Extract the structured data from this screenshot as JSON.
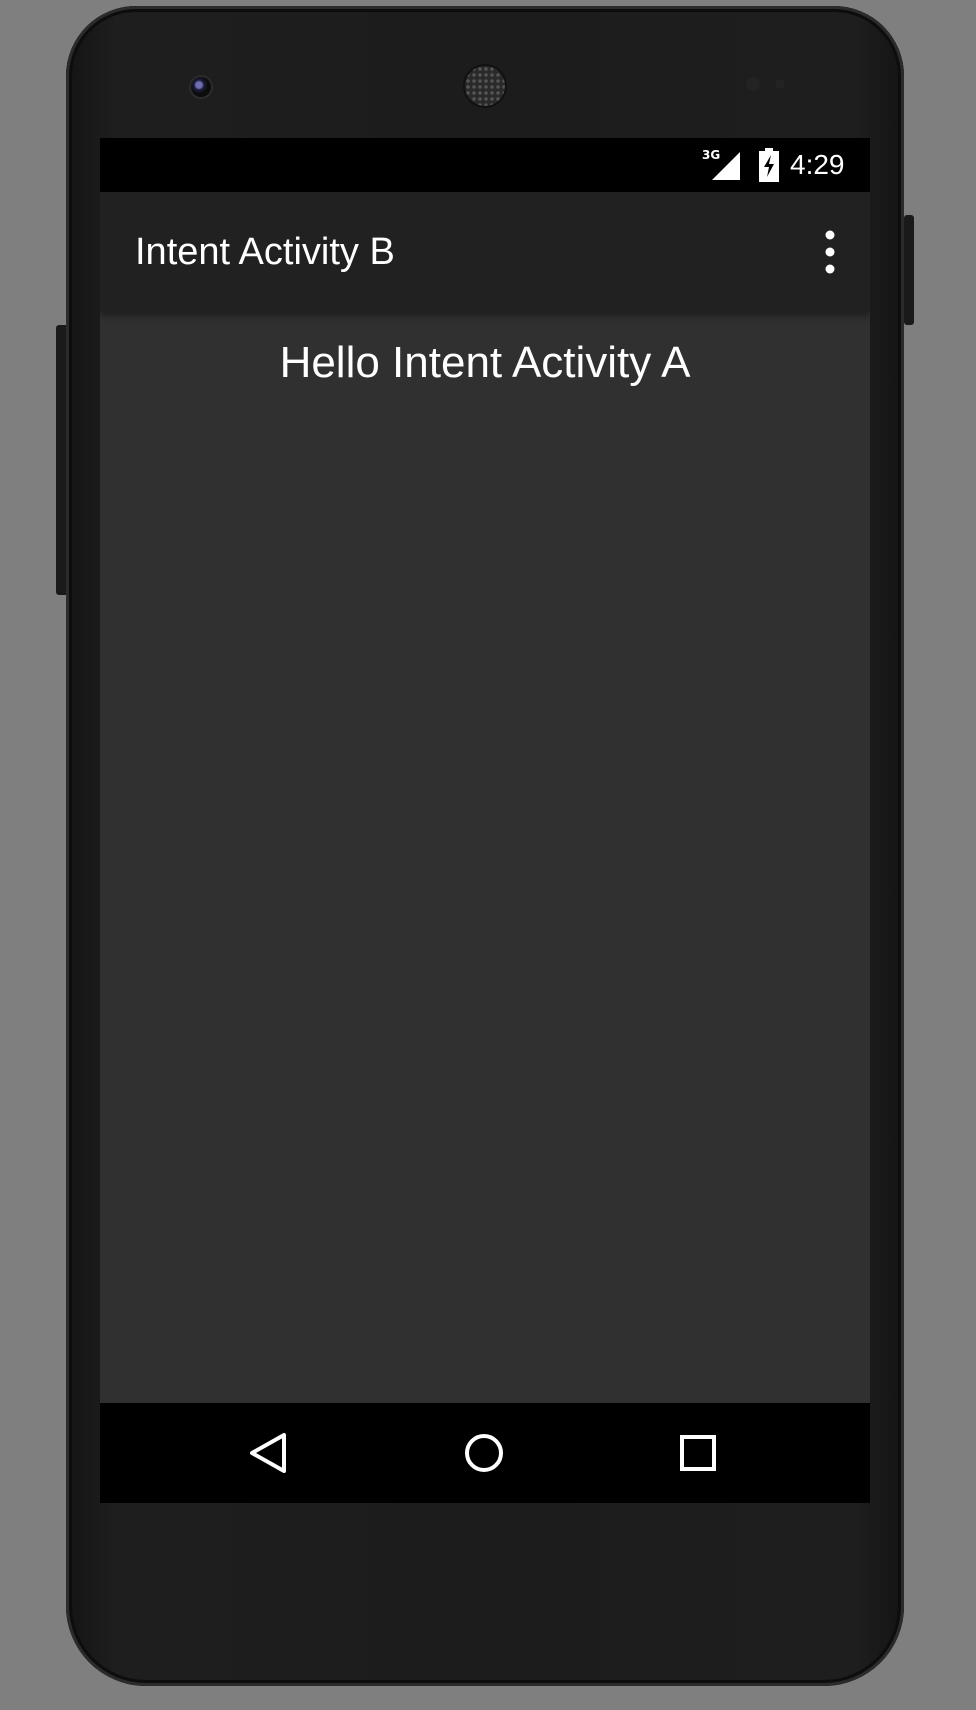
{
  "status_bar": {
    "network_label": "3G",
    "time": "4:29",
    "signal_icon": "cell-signal-icon",
    "battery_icon": "battery-charging-icon"
  },
  "action_bar": {
    "title": "Intent Activity B",
    "overflow_icon": "more-vert-icon"
  },
  "content": {
    "message": "Hello Intent Activity A"
  },
  "nav_bar": {
    "back_icon": "back-triangle-icon",
    "home_icon": "home-circle-icon",
    "recents_icon": "recents-square-icon"
  },
  "colors": {
    "background": "#7f7f7f",
    "screen": "#303030",
    "action_bar": "#212121",
    "status_bar": "#000000",
    "text": "#ffffff"
  }
}
